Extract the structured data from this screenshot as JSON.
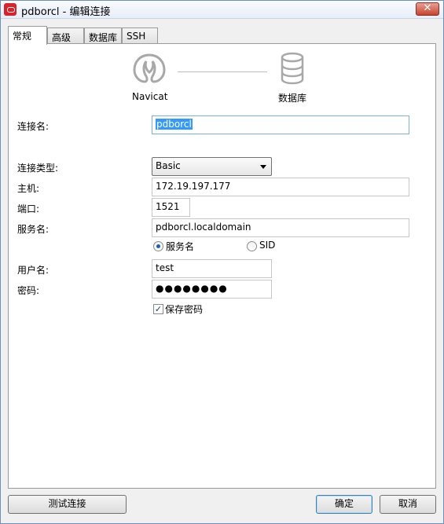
{
  "window": {
    "title": "pdborcl - 编辑连接",
    "close_label": "✕"
  },
  "tabs": [
    {
      "label": "常规",
      "active": true
    },
    {
      "label": "高级",
      "active": false
    },
    {
      "label": "数据库",
      "active": false
    },
    {
      "label": "SSH",
      "active": false
    }
  ],
  "diagram": {
    "left_label": "Navicat",
    "right_label": "数据库"
  },
  "form": {
    "connection_name": {
      "label": "连接名:",
      "value": "pdborcl"
    },
    "connection_type": {
      "label": "连接类型:",
      "value": "Basic"
    },
    "host": {
      "label": "主机:",
      "value": "172.19.197.177"
    },
    "port": {
      "label": "端口:",
      "value": "1521"
    },
    "service_name": {
      "label": "服务名:",
      "value": "pdborcl.localdomain"
    },
    "radio_service": {
      "label": "服务名",
      "selected": true
    },
    "radio_sid": {
      "label": "SID",
      "selected": false
    },
    "username": {
      "label": "用户名:",
      "value": "test"
    },
    "password": {
      "label": "密码:",
      "value": "●●●●●●●●"
    },
    "save_password": {
      "label": "保存密码",
      "checked": true,
      "check_glyph": "✓"
    }
  },
  "buttons": {
    "test": "测试连接",
    "ok": "确定",
    "cancel": "取消"
  }
}
